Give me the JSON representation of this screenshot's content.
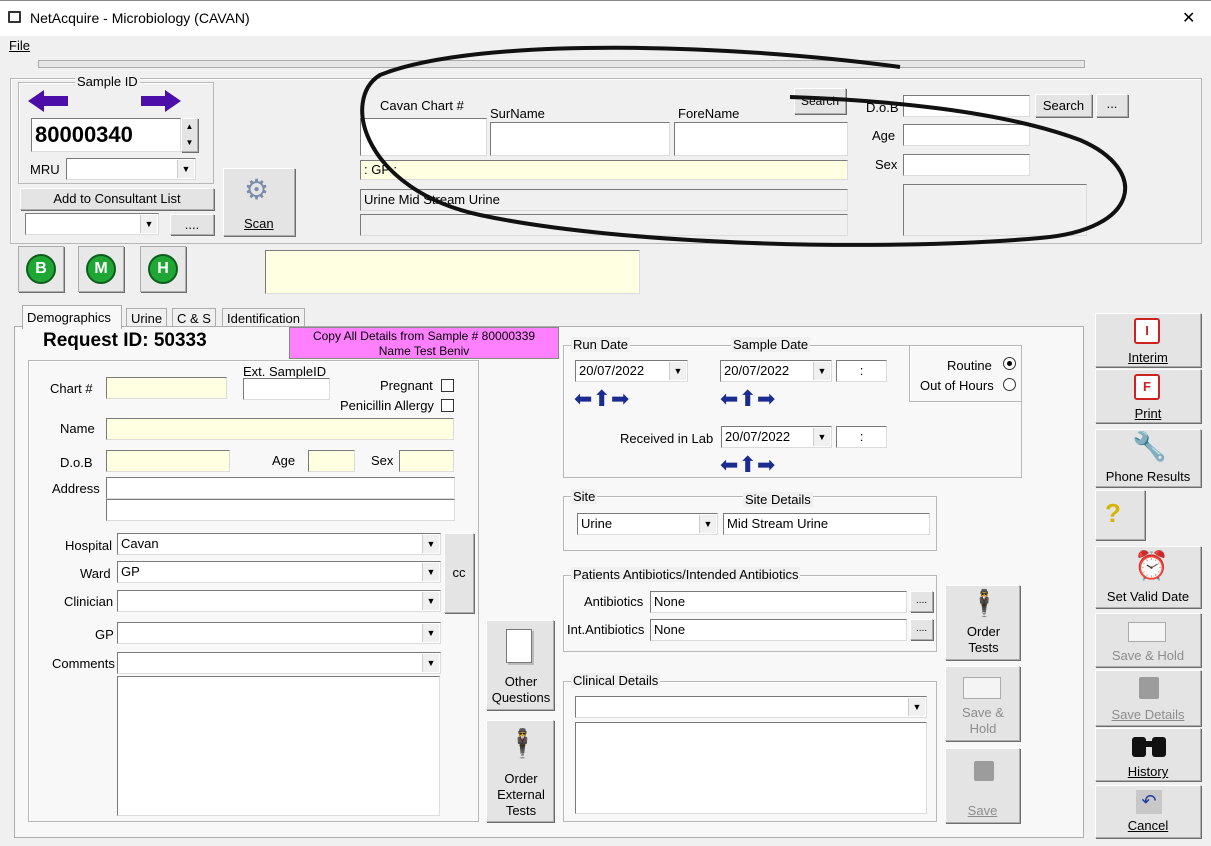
{
  "window": {
    "title": "NetAcquire - Microbiology (CAVAN)",
    "close_glyph": "✕"
  },
  "menu": {
    "file": "File"
  },
  "header": {
    "sample_id_label": "Sample ID",
    "sample_id_value": "80000340",
    "mru_label": "MRU",
    "add_to_consultant_label": "Add to Consultant List",
    "ellipsis": "....",
    "scan_label": "Scan",
    "chart_label": "Cavan Chart #",
    "surname_label": "SurName",
    "forename_label": "ForeName",
    "search_small_label": "Search",
    "dob_label": "D.o.B",
    "age_label": "Age",
    "sex_label": "Sex",
    "search_label": "Search",
    "search_more": "...",
    "gp_line": ": GP :",
    "sample_type_line": "Urine Mid Stream Urine"
  },
  "bmh": [
    "B",
    "M",
    "H"
  ],
  "tabs": [
    "Demographics",
    "Urine",
    "C & S",
    "Identification"
  ],
  "demographics": {
    "request_id": "Request ID: 50333",
    "copy_details": "Copy All Details from Sample # 80000339",
    "copy_name": "Name Test Beniv",
    "chart_label": "Chart #",
    "ext_sample_label": "Ext. SampleID",
    "pregnant_label": "Pregnant",
    "penicillin_label": "Penicillin Allergy",
    "name_label": "Name",
    "dob_label": "D.o.B",
    "age_label": "Age",
    "sex_label": "Sex",
    "address_label": "Address",
    "hospital_label": "Hospital",
    "hospital_value": "Cavan",
    "ward_label": "Ward",
    "ward_value": "GP",
    "cc_label": "cc",
    "clinician_label": "Clinician",
    "gp_label": "GP",
    "comments_label": "Comments"
  },
  "dates": {
    "run_date_label": "Run Date",
    "run_date_value": "20/07/2022",
    "sample_date_label": "Sample Date",
    "sample_date_value": "20/07/2022",
    "time_placeholder": ":",
    "received_label": "Received in Lab",
    "received_value": "20/07/2022",
    "routine_label": "Routine",
    "out_of_hours_label": "Out of Hours",
    "routine_selected": true
  },
  "site": {
    "site_label": "Site",
    "site_value": "Urine",
    "details_label": "Site Details",
    "details_value": "Mid Stream Urine"
  },
  "antibiotics": {
    "group_label": "Patients Antibiotics/Intended Antibiotics",
    "antibiotics_label": "Antibiotics",
    "antibiotics_value": "None",
    "int_label": "Int.Antibiotics",
    "int_value": "None",
    "more": "...."
  },
  "clinical": {
    "label": "Clinical Details"
  },
  "buttons": {
    "other_questions": "Other Questions",
    "order_external": "Order External Tests",
    "order_tests": "Order Tests",
    "save_hold": "Save & Hold",
    "save": "Save"
  },
  "sidebar": {
    "interim": "Interim",
    "print": "Print",
    "phone_results": "Phone Results",
    "set_valid_date": "Set Valid Date",
    "save_hold": "Save & Hold",
    "save_details": "Save Details",
    "history": "History",
    "cancel": "Cancel"
  },
  "colors": {
    "accent_arrow": "#4b0ea8",
    "gp_bar": "#ffffe1",
    "copy_button": "#ff80ff",
    "bmh_green": "#1fa635"
  }
}
